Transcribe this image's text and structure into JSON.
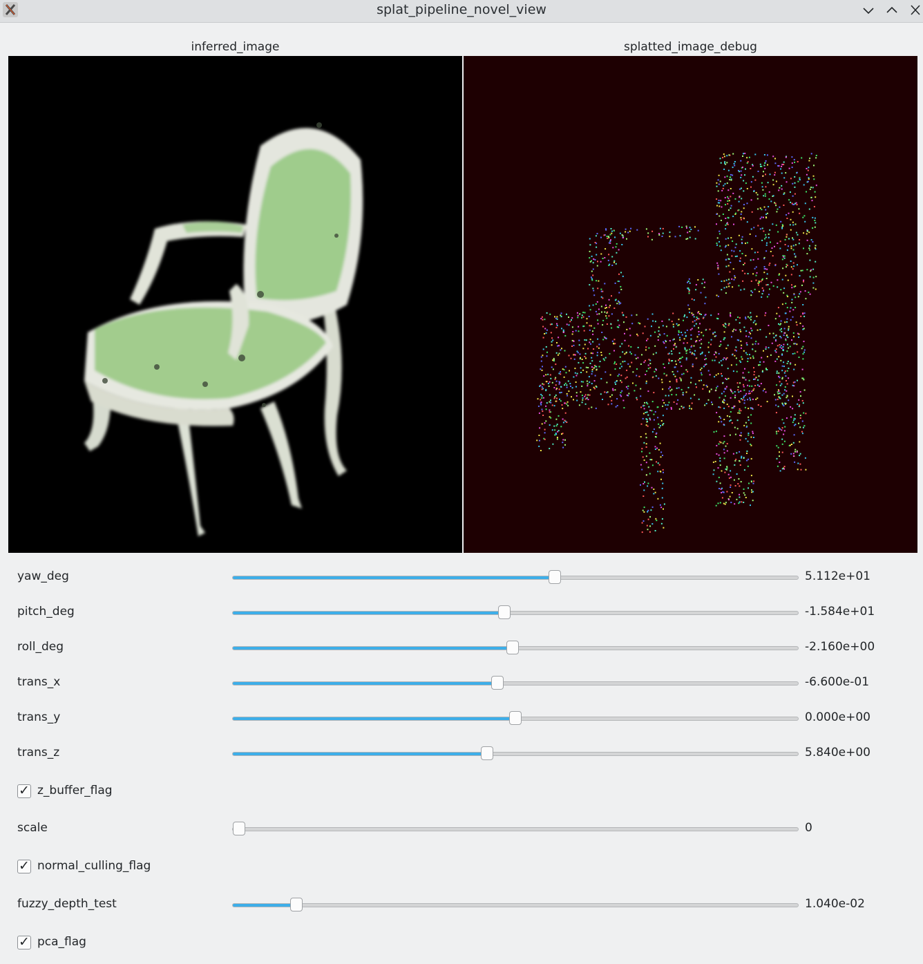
{
  "window": {
    "title": "splat_pipeline_novel_view",
    "app_icon": "x-app-icon"
  },
  "images": {
    "left": {
      "label": "inferred_image",
      "background": "#000000"
    },
    "right": {
      "label": "splatted_image_debug",
      "background": "#1e0002"
    }
  },
  "controls": {
    "yaw_deg": {
      "label": "yaw_deg",
      "value": "5.112e+01",
      "fraction": 0.57
    },
    "pitch_deg": {
      "label": "pitch_deg",
      "value": "-1.584e+01",
      "fraction": 0.48
    },
    "roll_deg": {
      "label": "roll_deg",
      "value": "-2.160e+00",
      "fraction": 0.495
    },
    "trans_x": {
      "label": "trans_x",
      "value": "-6.600e-01",
      "fraction": 0.468
    },
    "trans_y": {
      "label": "trans_y",
      "value": "0.000e+00",
      "fraction": 0.5
    },
    "trans_z": {
      "label": "trans_z",
      "value": "5.840e+00",
      "fraction": 0.45
    },
    "z_buffer_flag": {
      "label": "z_buffer_flag",
      "checked": true
    },
    "scale": {
      "label": "scale",
      "value": "0",
      "fraction": 0.0
    },
    "normal_culling_flag": {
      "label": "normal_culling_flag",
      "checked": true
    },
    "fuzzy_depth_test": {
      "label": "fuzzy_depth_test",
      "value": "1.040e-02",
      "fraction": 0.112
    },
    "pca_flag": {
      "label": "pca_flag",
      "checked": true
    }
  },
  "colors": {
    "accent": "#3daee9",
    "window_bg": "#eff0f1"
  }
}
